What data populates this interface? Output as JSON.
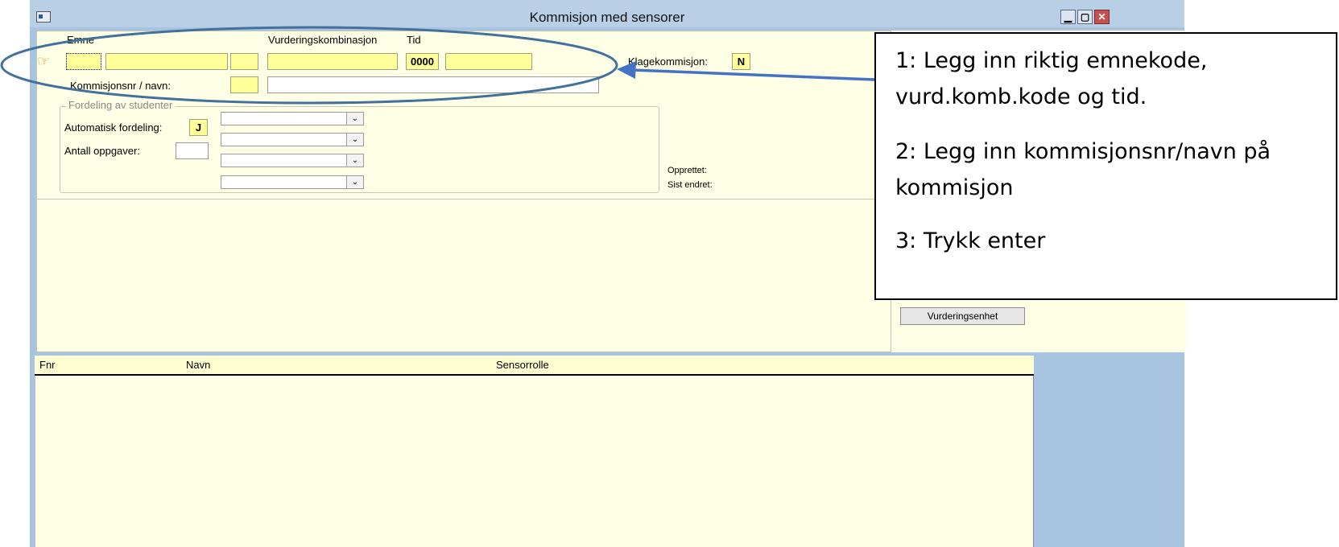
{
  "window": {
    "title": "Kommisjon med sensorer",
    "minimize": "▁",
    "maximize": "▢",
    "close": "✕"
  },
  "headers": {
    "emne": "Emne",
    "vurderingskombinasjon": "Vurderingskombinasjon",
    "tid": "Tid"
  },
  "form": {
    "tid_value": "0000",
    "klagekommisjon_label": "Klagekommisjon:",
    "klagekommisjon_value": "N",
    "kommisjonsnr_label": "Kommisjonsnr / navn:",
    "group_title": "Fordeling av studenter",
    "automatisk_label": "Automatisk fordeling:",
    "automatisk_value": "J",
    "antall_label": "Antall oppgaver:",
    "opprettet_label": "Opprettet:",
    "sist_endret_label": "Sist endret:",
    "vurderingsenhet_button": "Vurderingsenhet"
  },
  "grid": {
    "columns": [
      "Fnr",
      "Navn",
      "Sensorrolle"
    ]
  },
  "callout": {
    "line1": "1: Legg inn riktig emnekode,",
    "line2": "vurd.komb.kode og tid.",
    "line3": "2: Legg inn kommisjonsnr/navn på",
    "line4": "kommisjon",
    "line5": "3: Trykk enter"
  },
  "colors": {
    "annotation": "#41719c",
    "field_yellow": "#ffff99",
    "panel_background": "#ffffe6"
  }
}
